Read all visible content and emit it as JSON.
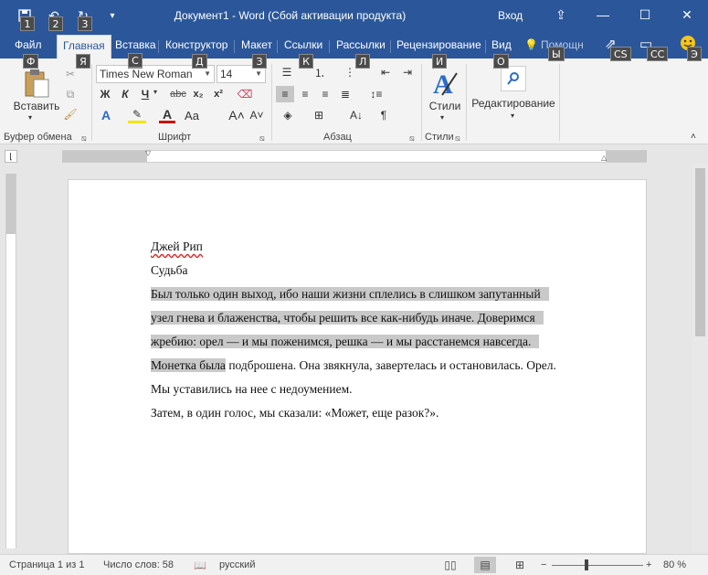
{
  "window": {
    "title": "Документ1  -  Word (Сбой активации продукта)",
    "signin": "Вход",
    "qat_keytips": [
      "1",
      "2",
      "3"
    ]
  },
  "tabs": [
    {
      "label": "Файл",
      "keytip": "Ф"
    },
    {
      "label": "Главная",
      "keytip": "Я"
    },
    {
      "label": "Вставка",
      "keytip": "С"
    },
    {
      "label": "Конструктор",
      "keytip": "Д"
    },
    {
      "label": "Макет",
      "keytip": "З"
    },
    {
      "label": "Ссылки",
      "keytip": "К"
    },
    {
      "label": "Рассылки",
      "keytip": "Л"
    },
    {
      "label": "Рецензирование",
      "keytip": "И"
    },
    {
      "label": "Вид",
      "keytip": "О"
    }
  ],
  "tell_me": {
    "placeholder": "Помощн",
    "keytip": "Ы"
  },
  "right_keytips": [
    "CS",
    "СС",
    "Э"
  ],
  "ribbon": {
    "clipboard": {
      "label": "Буфер обмена",
      "paste": "Вставить"
    },
    "font": {
      "label": "Шрифт",
      "font_name": "Times New Roman",
      "font_size": "14"
    },
    "paragraph": {
      "label": "Абзац"
    },
    "styles": {
      "label": "Стили",
      "styles_btn": "Стили"
    },
    "editing": {
      "label": "Редактирование"
    }
  },
  "document": {
    "author": "Джей Рип",
    "title": "Судьба",
    "lines": [
      "Был только один выход, ибо наши жизни сплелись в слишком запутанный",
      "узел гнева и блаженства, чтобы решить все как-нибудь иначе. Доверимся",
      "жребию: орел — и мы поженимся, решка — и мы расстанемся навсегда.",
      "Монетка была",
      " подброшена. Она звякнула, завертелась и остановилась. Орел.",
      "Мы уставились на нее с недоумением.",
      "Затем, в один голос, мы сказали: «Может, еще разок?»."
    ]
  },
  "statusbar": {
    "page": "Страница 1 из 1",
    "words": "Число слов: 58",
    "language": "русский",
    "zoom": "80 %"
  }
}
